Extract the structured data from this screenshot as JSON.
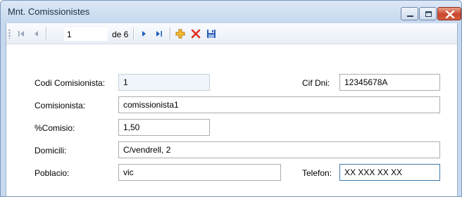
{
  "window": {
    "title": "Mnt. Comissionistes"
  },
  "navigator": {
    "position": "1",
    "count_label": "de 6"
  },
  "form": {
    "codi": {
      "label": "Codi Comisionista:",
      "value": "1"
    },
    "cif": {
      "label": "Cif Dni:",
      "value": "12345678A"
    },
    "comisionista": {
      "label": "Comisionista:",
      "value": "comissionista1"
    },
    "comisio": {
      "label": "%Comisio:",
      "value": "1,50"
    },
    "domicili": {
      "label": "Domicili:",
      "value": "C/vendrell, 2"
    },
    "poblacio": {
      "label": "Poblacio:",
      "value": "vic"
    },
    "telefon": {
      "label": "Telefon:",
      "value": "XX XXX XX XX"
    }
  },
  "colors": {
    "accent_blue": "#1f5fbf",
    "add_orange": "#e8a21a",
    "delete_red": "#e0301e"
  }
}
